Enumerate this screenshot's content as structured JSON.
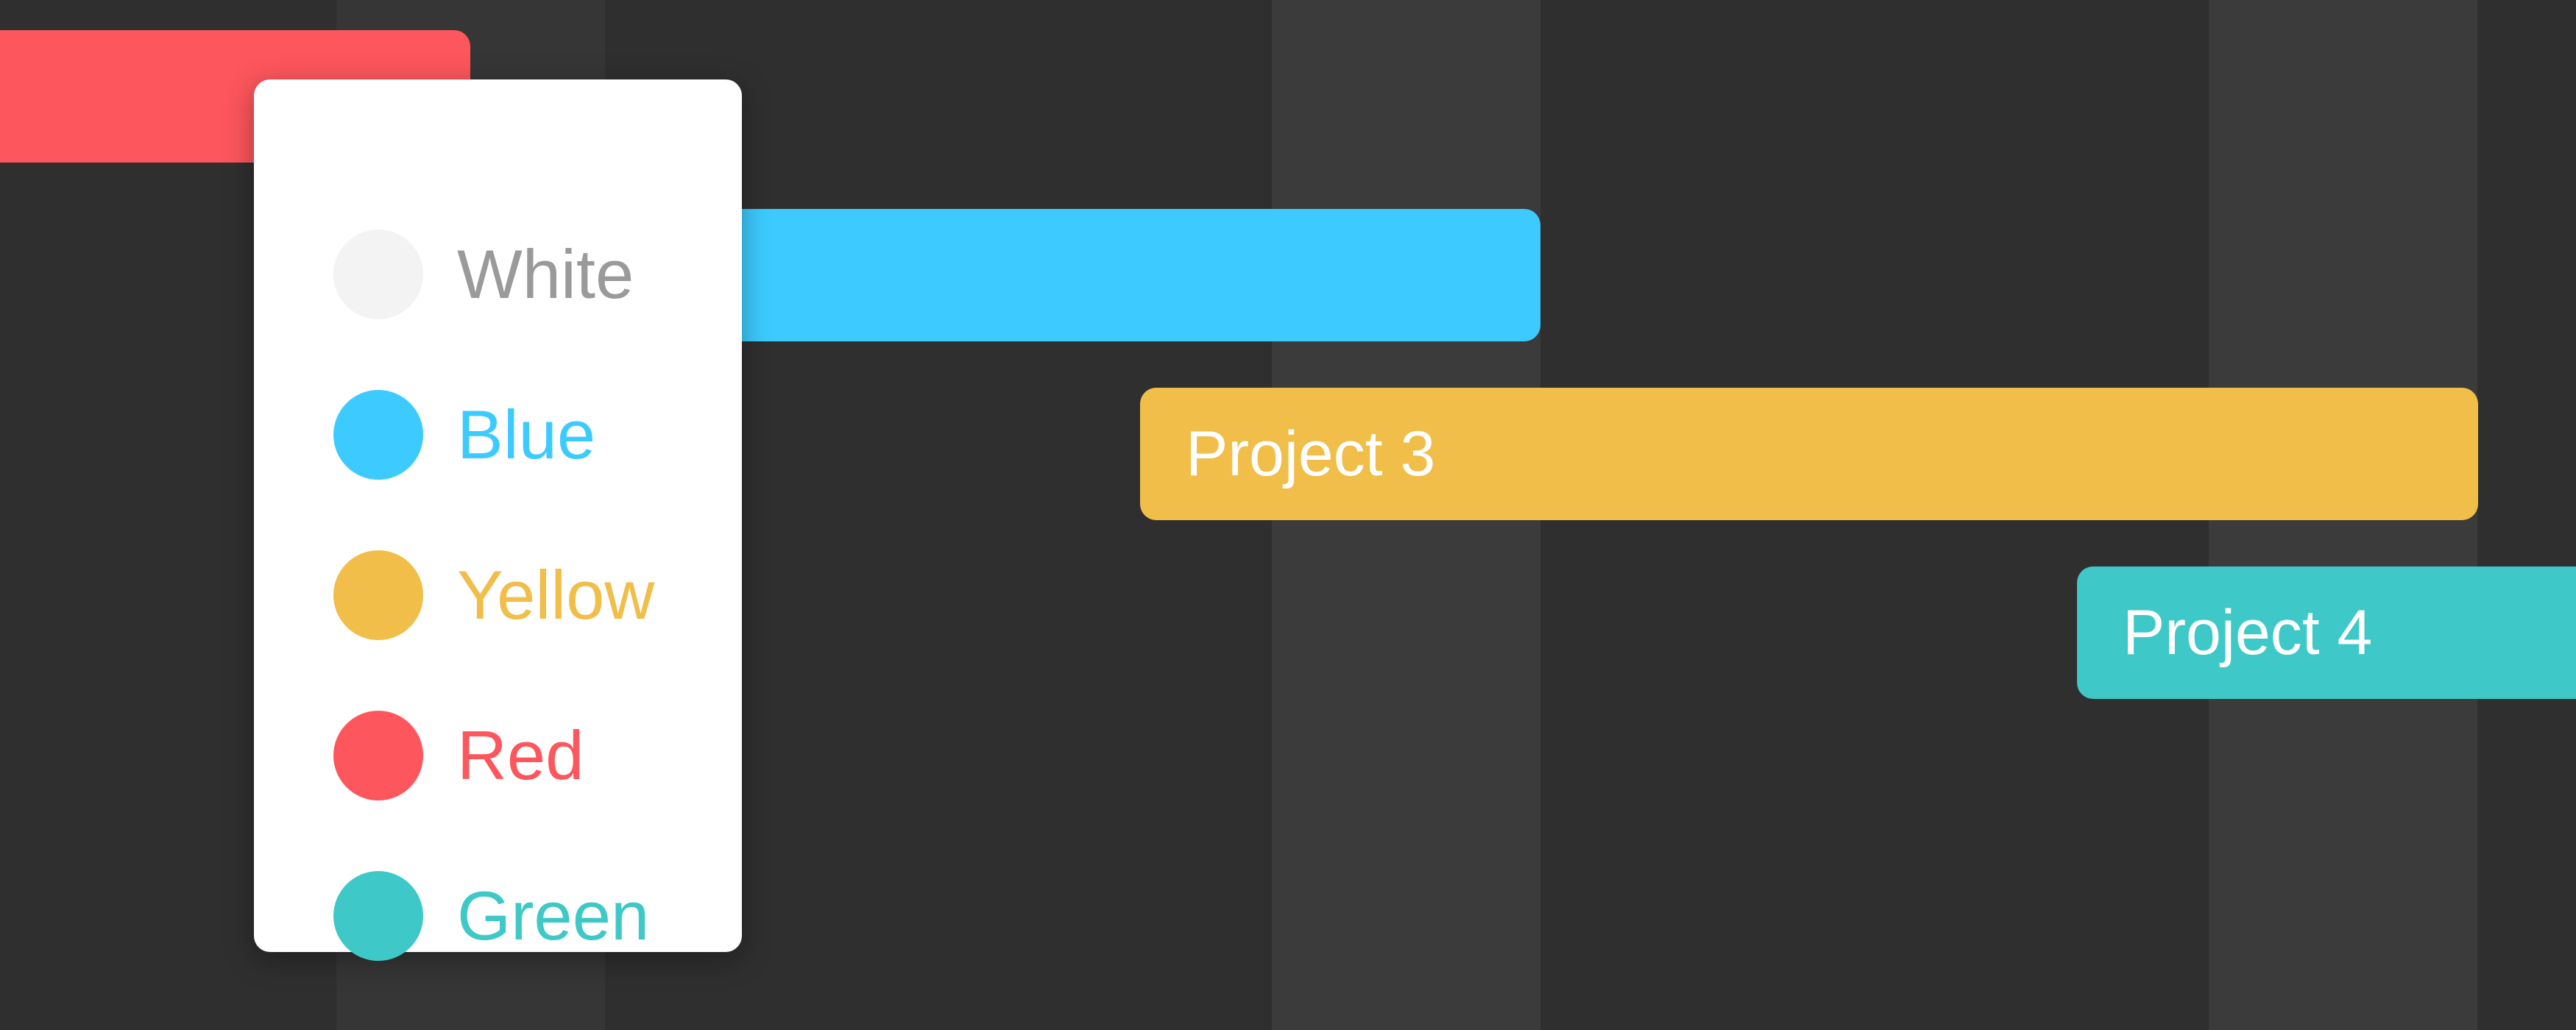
{
  "projects": [
    {
      "label": "",
      "color": "#fd565c"
    },
    {
      "label": "",
      "color": "#3dcbff"
    },
    {
      "label": "Project 3",
      "color": "#f0be49"
    },
    {
      "label": "Project 4",
      "color": "#3ec9c8"
    }
  ],
  "color_menu": {
    "items": [
      {
        "label": "White",
        "swatch": "#f3f3f3",
        "text_color": "#9a9a9a"
      },
      {
        "label": "Blue",
        "swatch": "#3dcbff",
        "text_color": "#3dcbff"
      },
      {
        "label": "Yellow",
        "swatch": "#f0be49",
        "text_color": "#f0be49"
      },
      {
        "label": "Red",
        "swatch": "#fd565c",
        "text_color": "#fd565c"
      },
      {
        "label": "Green",
        "swatch": "#3ec9c8",
        "text_color": "#3ec9c8"
      }
    ]
  }
}
